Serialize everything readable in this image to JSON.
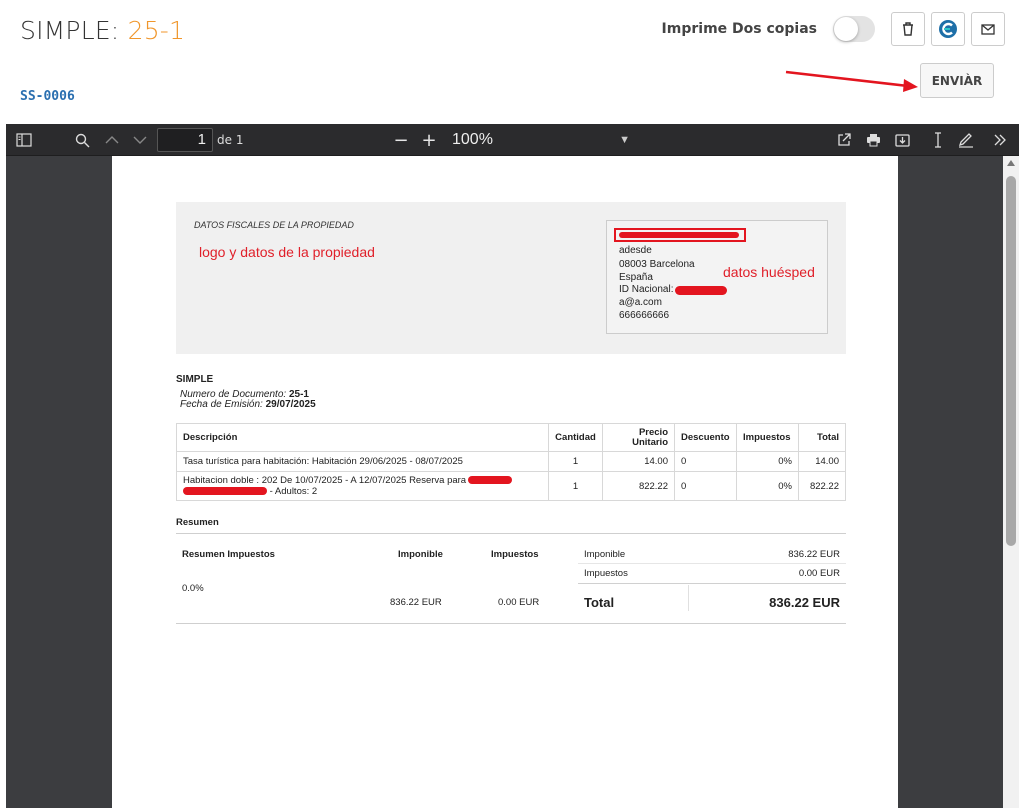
{
  "header": {
    "title_prefix": "SIMPLE: ",
    "title_number": "25-1",
    "print_copies_label": "Imprime Dos copias",
    "code": "SS-0006",
    "send_label": "ENVIÀR"
  },
  "viewer": {
    "page_number": "1",
    "page_of": "de 1",
    "zoom": "100%"
  },
  "document": {
    "fiscal_title": "DATOS FISCALES DE LA PROPIEDAD",
    "logo_annotation": "logo y datos de la propiedad",
    "guest_annotation": "datos huésped",
    "guest": {
      "address": "adesde",
      "city": "08003 Barcelona",
      "country": "España",
      "id_label": "ID Nacional:",
      "email": "a@a.com",
      "phone": "666666666"
    },
    "doc_type": "SIMPLE",
    "doc_number_label": "Numero de Documento: ",
    "doc_number": "25-1",
    "issue_date_label": "Fecha de Emisión: ",
    "issue_date": "29/07/2025",
    "table": {
      "headers": {
        "description": "Descripción",
        "quantity": "Cantidad",
        "unit_price_1": "Precio",
        "unit_price_2": "Unitario",
        "discount": "Descuento",
        "taxes": "Impuestos",
        "total": "Total"
      },
      "rows": [
        {
          "description": "Tasa turística para habitación: Habitación 29/06/2025 - 08/07/2025",
          "quantity": "1",
          "unit_price": "14.00",
          "discount": "0",
          "taxes": "0%",
          "total": "14.00"
        },
        {
          "description": "Habitacion doble : 202 De 10/07/2025 - A 12/07/2025 Reserva para",
          "description_2": "- Adultos: 2",
          "quantity": "1",
          "unit_price": "822.22",
          "discount": "0",
          "taxes": "0%",
          "total": "822.22"
        }
      ]
    },
    "summary": {
      "title": "Resumen",
      "tax_summary_label": "Resumen Impuestos",
      "taxable_label": "Imponible",
      "taxes_label": "Impuestos",
      "rate": "0.0%",
      "taxable_value": "836.22 EUR",
      "taxes_value": "0.00 EUR",
      "right_taxable_label": "Imponible",
      "right_taxable_value": "836.22 EUR",
      "right_taxes_label": "Impuestos",
      "right_taxes_value": "0.00 EUR",
      "total_label": "Total",
      "total_value": "836.22 EUR"
    }
  },
  "colors": {
    "accent_orange": "#f0962b",
    "code_blue": "#2a6fb0",
    "annotation_red": "#e0202a",
    "viewer_bg": "#3c3d40",
    "toolbar_bg": "#2b2b2d"
  }
}
